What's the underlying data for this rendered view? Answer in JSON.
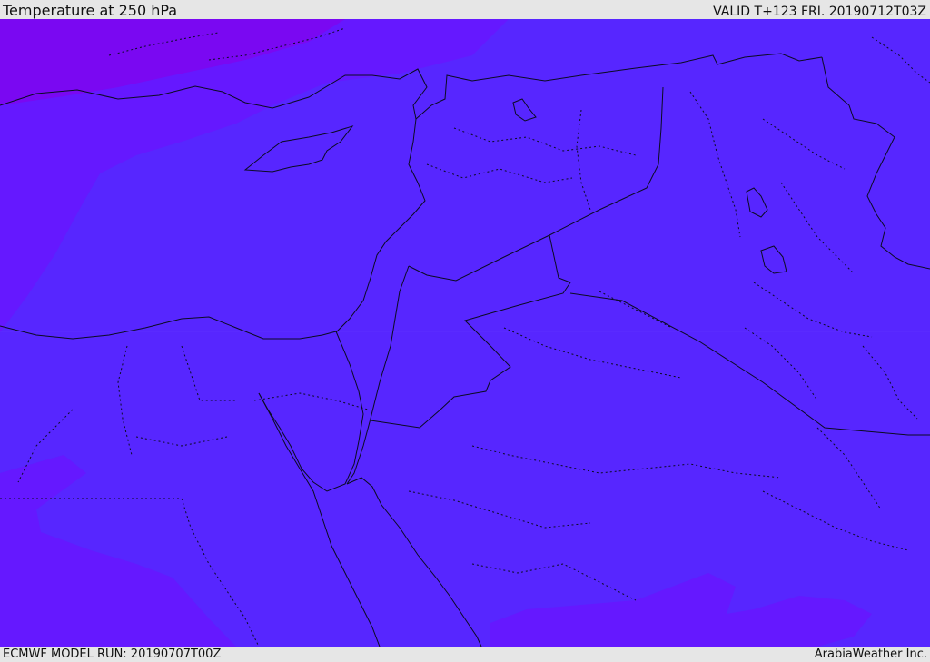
{
  "header": {
    "title": "Temperature at 250 hPa",
    "valid_time": "VALID T+123 FRI. 20190712T03Z"
  },
  "footer": {
    "model_run": "ECMWF MODEL RUN: 20190707T00Z",
    "credit": "ArabiaWeather Inc."
  },
  "map": {
    "field": "temperature",
    "level": "250 hPa",
    "colors": {
      "base": "#5726ff",
      "cooler": "#6518ff",
      "coldest": "#7a08f2",
      "border_line": "#0b0b22"
    }
  }
}
